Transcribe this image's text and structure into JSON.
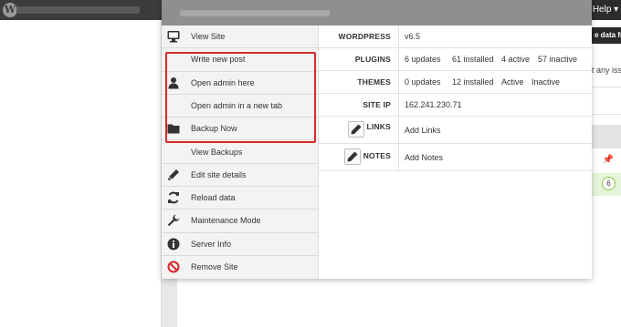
{
  "topbar": {
    "help_label": "Help ▾"
  },
  "background": {
    "button_text": "e data fr",
    "row_text": "t any iss",
    "badge": "6"
  },
  "menu": {
    "items": [
      {
        "label": "View Site",
        "icon": "monitor-icon"
      },
      {
        "label": "Write new post",
        "icon": ""
      },
      {
        "label": "Open admin here",
        "icon": "user-icon"
      },
      {
        "label": "Open admin in a new tab",
        "icon": ""
      },
      {
        "label": "Backup Now",
        "icon": "folder-icon"
      },
      {
        "label": "View Backups",
        "icon": ""
      },
      {
        "label": "Edit site details",
        "icon": "pencil-icon"
      },
      {
        "label": "Reload data",
        "icon": "refresh-icon"
      },
      {
        "label": "Maintenance Mode",
        "icon": "wrench-icon"
      },
      {
        "label": "Server Info",
        "icon": "info-icon"
      },
      {
        "label": "Remove Site",
        "icon": "ban-icon"
      }
    ]
  },
  "info": {
    "wordpress": {
      "key": "WORDPRESS",
      "version": "v6.5"
    },
    "plugins": {
      "key": "PLUGINS",
      "updates": "6 updates",
      "installed": "61 installed",
      "active": "4 active",
      "inactive": "57 inactive"
    },
    "themes": {
      "key": "THEMES",
      "updates": "0 updates",
      "installed": "12 installed",
      "active": "Active",
      "inactive": "Inactive"
    },
    "site_ip": {
      "key": "SITE IP",
      "value": "162.241.230.71"
    },
    "links": {
      "key": "LINKS",
      "value": "Add Links"
    },
    "notes": {
      "key": "NOTES",
      "value": "Add Notes"
    }
  },
  "colors": {
    "topbar": "#3c3c3c",
    "dropdown_header": "#8f8f8f",
    "highlight": "#d42a2a",
    "link": "#e1462b",
    "menu_bg": "#f3f3f3"
  }
}
